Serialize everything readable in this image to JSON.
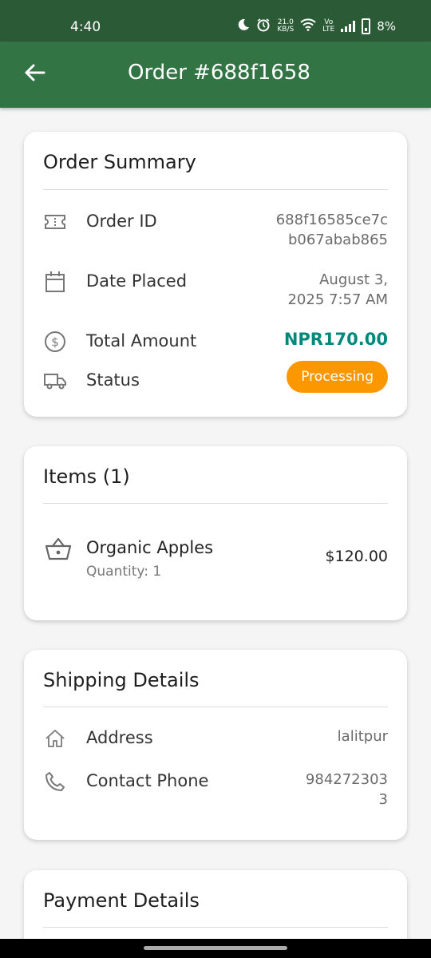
{
  "status_bar": {
    "time": "4:40",
    "net_speed_top": "21.0",
    "net_speed_unit": "KB/S",
    "volte_top": "Vo",
    "volte_bottom": "LTE",
    "battery": "8%"
  },
  "app_bar": {
    "title": "Order #688f1658",
    "back_icon": "arrow-left-icon"
  },
  "order_summary": {
    "title": "Order Summary",
    "order_id": {
      "label": "Order ID",
      "value_line1": "688f16585ce7c",
      "value_line2": "b067abab865",
      "icon": "ticket-icon"
    },
    "date_placed": {
      "label": "Date Placed",
      "value_line1": "August 3,",
      "value_line2": "2025 7:57 AM",
      "icon": "calendar-icon"
    },
    "total_amount": {
      "label": "Total Amount",
      "value": "NPR170.00",
      "icon": "dollar-circle-icon"
    },
    "status": {
      "label": "Status",
      "value": "Processing",
      "icon": "truck-icon"
    }
  },
  "items": {
    "title": "Items (1)",
    "list": [
      {
        "name": "Organic Apples",
        "quantity": "Quantity: 1",
        "price": "$120.00",
        "icon": "basket-icon"
      }
    ]
  },
  "shipping": {
    "title": "Shipping Details",
    "address": {
      "label": "Address",
      "value": "lalitpur",
      "icon": "home-icon"
    },
    "phone": {
      "label": "Contact Phone",
      "value_line1": "984272303",
      "value_line2": "3",
      "icon": "phone-icon"
    }
  },
  "payment": {
    "title": "Payment Details"
  },
  "colors": {
    "status_bar": "#2b5a36",
    "app_bar": "#337444",
    "total": "#00897b",
    "badge": "#fb9800"
  }
}
